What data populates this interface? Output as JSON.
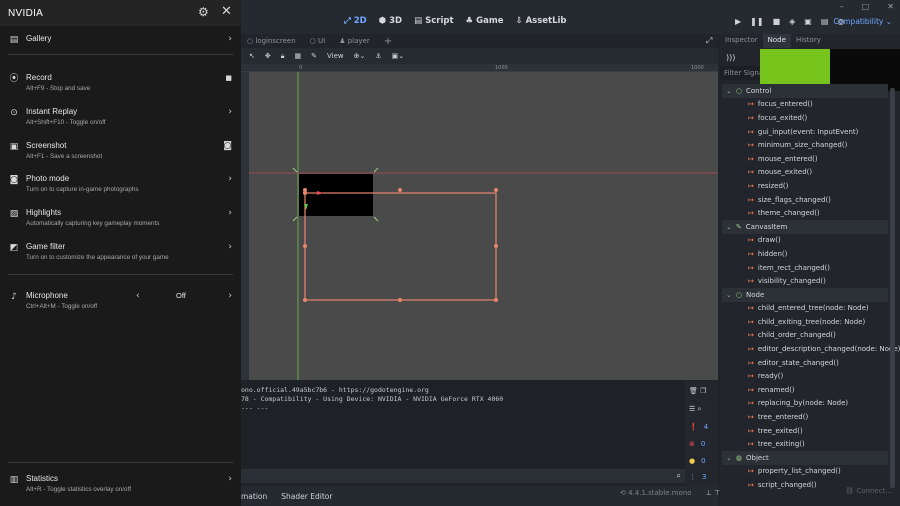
{
  "nvidia": {
    "title": "NVIDIA",
    "items": [
      {
        "label": "Gallery",
        "sub": ""
      },
      {
        "label": "Record",
        "sub": "Alt+F9 - Stop and save"
      },
      {
        "label": "Instant Replay",
        "sub": "Alt+Shift+F10 - Toggle on/off"
      },
      {
        "label": "Screenshot",
        "sub": "Alt+F1 - Save a screenshot"
      },
      {
        "label": "Photo mode",
        "sub": "Turn on to capture in-game photographs"
      },
      {
        "label": "Highlights",
        "sub": "Automatically capturing key gameplay moments"
      },
      {
        "label": "Game filter",
        "sub": "Turn on to customize the appearance of your game"
      },
      {
        "label": "Microphone",
        "sub": "Ctrl+Alt+M - Toggle on/off",
        "value": "Off"
      },
      {
        "label": "Statistics",
        "sub": "Alt+R - Toggle statistics overlay on/off"
      }
    ]
  },
  "editor": {
    "main_tabs": [
      "2D",
      "3D",
      "Script",
      "Game",
      "AssetLib"
    ],
    "renderer": "Compatibility",
    "scene_tabs": [
      "loginscreen",
      "UI",
      "player"
    ],
    "view_label": "View",
    "ruler_marks": [
      "0",
      "1000",
      "1000"
    ],
    "output_lines": [
      "ono.official.49a5bc7b6 - https://godotengine.org",
      "78 - Compatibility - Using Device: NVIDIA - NVIDIA GeForce RTX 4060",
      "",
      "--- ---"
    ],
    "counts": {
      "logs": "4",
      "errors": "0",
      "warnings": "0",
      "info": "3"
    },
    "bottom_tabs": [
      "mation",
      "Shader Editor"
    ],
    "version": "4.4.1.stable.mono",
    "dock_tabs": [
      "Inspector",
      "Node",
      "History"
    ],
    "filter_placeholder": "Filter Signals",
    "connect_label": "Connect...",
    "signal_groups": [
      {
        "name": "Control",
        "signals": [
          "focus_entered()",
          "focus_exited()",
          "gui_input(event: InputEvent)",
          "minimum_size_changed()",
          "mouse_entered()",
          "mouse_exited()",
          "resized()",
          "size_flags_changed()",
          "theme_changed()"
        ]
      },
      {
        "name": "CanvasItem",
        "signals": [
          "draw()",
          "hidden()",
          "item_rect_changed()",
          "visibility_changed()"
        ]
      },
      {
        "name": "Node",
        "signals": [
          "child_entered_tree(node: Node)",
          "child_exiting_tree(node: Node)",
          "child_order_changed()",
          "editor_description_changed(node: Node)",
          "editor_state_changed()",
          "ready()",
          "renamed()",
          "replacing_by(node: Node)",
          "tree_entered()",
          "tree_exited()",
          "tree_exiting()"
        ]
      },
      {
        "name": "Object",
        "signals": [
          "property_list_changed()",
          "script_changed()"
        ]
      }
    ]
  }
}
